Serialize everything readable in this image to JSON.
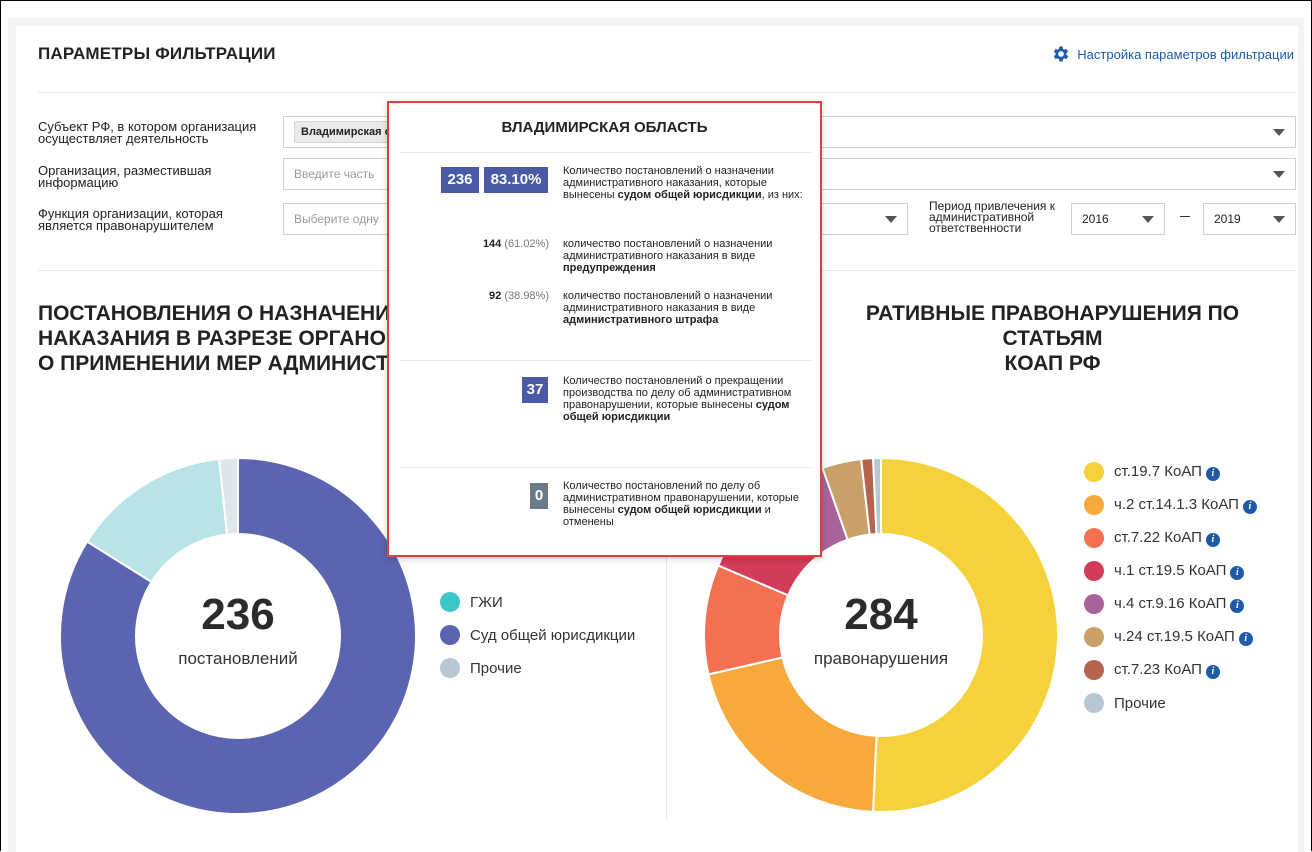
{
  "filters": {
    "title": "ПАРАМЕТРЫ ФИЛЬТРАЦИИ",
    "settings_link": "Настройка параметров фильтрации",
    "subject_label": "Субъект РФ, в котором организация осуществляет деятельность",
    "subject_chip": "Владимирская о",
    "org_label": "Организация, разместившая информацию",
    "org_placeholder": "Введите часть",
    "function_label": "Функция организации, которая является правонарушителем",
    "function_placeholder": "Выберите одну",
    "period_label": "Период привлечения к административной ответственности",
    "year_from": "2016",
    "year_to": "2019"
  },
  "left_chart": {
    "title_lines": [
      "ПОСТАНОВЛЕНИЯ О НАЗНАЧЕНИИ",
      "НАКАЗАНИЯ В РАЗРЕЗЕ ОРГАНОВ",
      "О ПРИМЕНЕНИИ МЕР АДМИНИСТР"
    ],
    "center_number": "236",
    "center_label": "постановлений",
    "legend": [
      {
        "label": "ГЖИ",
        "color": "#3cc8c8"
      },
      {
        "label": "Суд общей юрисдикции",
        "color": "#5a64b0"
      },
      {
        "label": "Прочие",
        "color": "#b8c8d2"
      }
    ]
  },
  "right_chart": {
    "title_lines": [
      "РАТИВНЫЕ ПРАВОНАРУШЕНИЯ ПО СТАТЬЯМ",
      "КОАП РФ"
    ],
    "center_number": "284",
    "center_label": "правонарушения",
    "legend": [
      {
        "label": "ст.19.7 КоАП",
        "color": "#f5d23c",
        "info": true
      },
      {
        "label": "ч.2 ст.14.1.3 КоАП",
        "color": "#f8a93c",
        "info": true
      },
      {
        "label": "ст.7.22 КоАП",
        "color": "#f47050",
        "info": true
      },
      {
        "label": "ч.1 ст.19.5 КоАП",
        "color": "#d23c5a",
        "info": true
      },
      {
        "label": "ч.4 ст.9.16 КоАП",
        "color": "#a8649a",
        "info": true
      },
      {
        "label": "ч.24 ст.19.5 КоАП",
        "color": "#c8a068",
        "info": true
      },
      {
        "label": "ст.7.23 КоАП",
        "color": "#b4644b",
        "info": true
      },
      {
        "label": "Прочие",
        "color": "#b8c8d2",
        "info": false
      }
    ]
  },
  "chart_data": [
    {
      "type": "pie",
      "title": "",
      "labels": [
        "Суд общей юрисдикции",
        "ГЖИ",
        "Прочие"
      ],
      "values": [
        198,
        34,
        4
      ],
      "colors": [
        "#5a64b0",
        "#b8e4e8",
        "#dde6ea"
      ]
    },
    {
      "type": "pie",
      "title": "",
      "labels": [
        "ст.19.7 КоАП",
        "ч.2 ст.14.1.3 КоАП",
        "ст.7.22 КоАП",
        "ч.1 ст.19.5 КоАП",
        "ч.4 ст.9.16 КоАП",
        "ч.24 ст.19.5 КоАП",
        "ст.7.23 КоАП",
        "Прочие"
      ],
      "values": [
        142,
        58,
        28,
        22,
        15,
        10,
        3,
        2
      ],
      "colors": [
        "#f5d23c",
        "#f8a93c",
        "#f47050",
        "#d23c5a",
        "#a8649a",
        "#c8a068",
        "#b4644b",
        "#b8c8d2"
      ]
    }
  ],
  "tooltip": {
    "title": "ВЛАДИМИРСКАЯ ОБЛАСТЬ",
    "main_count": "236",
    "main_pct": "83.10%",
    "main_text": "Количество постановлений о назначении административного наказания, которые вынесены",
    "main_bold": "судом общей юрисдикции",
    "main_tail": ", из них:",
    "sub1_count": "144",
    "sub1_pct": "(61.02%)",
    "sub1_text": "количество постановлений о назначении административного наказания в виде",
    "sub1_bold": "предупреждения",
    "sub2_count": "92",
    "sub2_pct": "(38.98%)",
    "sub2_text": "количество постановлений о назначении административного наказания в виде",
    "sub2_bold": "административного штрафа",
    "term_count": "37",
    "term_text": "Количество постановлений о прекращении производства по делу об административном правонарушении, которые вынесены",
    "term_bold": "судом общей юрисдикции",
    "cancel_count": "0",
    "cancel_text": "Количество постановлений по делу об административном правонарушении, которые вынесены",
    "cancel_bold": "судом общей юрисдикции",
    "cancel_tail": "и отменены"
  }
}
